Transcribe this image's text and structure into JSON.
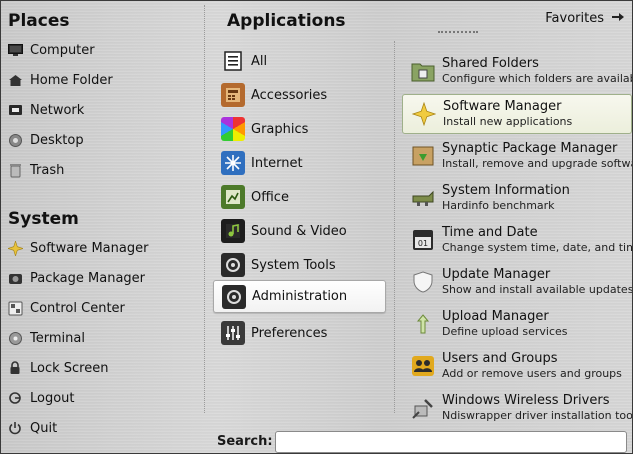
{
  "places": {
    "title": "Places",
    "items": [
      {
        "label": "Computer",
        "icon": "monitor-icon"
      },
      {
        "label": "Home Folder",
        "icon": "home-icon"
      },
      {
        "label": "Network",
        "icon": "network-icon"
      },
      {
        "label": "Desktop",
        "icon": "desktop-icon"
      },
      {
        "label": "Trash",
        "icon": "trash-icon"
      }
    ]
  },
  "system": {
    "title": "System",
    "items": [
      {
        "label": "Software Manager",
        "icon": "software-manager-icon"
      },
      {
        "label": "Package Manager",
        "icon": "package-manager-icon"
      },
      {
        "label": "Control Center",
        "icon": "control-center-icon"
      },
      {
        "label": "Terminal",
        "icon": "terminal-icon"
      },
      {
        "label": "Lock Screen",
        "icon": "lock-icon"
      },
      {
        "label": "Logout",
        "icon": "logout-icon"
      },
      {
        "label": "Quit",
        "icon": "power-icon"
      }
    ]
  },
  "applications": {
    "title": "Applications",
    "favorites_label": "Favorites",
    "categories": [
      {
        "label": "All",
        "icon": "all-apps-icon"
      },
      {
        "label": "Accessories",
        "icon": "accessories-icon"
      },
      {
        "label": "Graphics",
        "icon": "graphics-icon"
      },
      {
        "label": "Internet",
        "icon": "internet-icon"
      },
      {
        "label": "Office",
        "icon": "office-icon"
      },
      {
        "label": "Sound & Video",
        "icon": "sound-video-icon"
      },
      {
        "label": "System Tools",
        "icon": "system-tools-icon"
      },
      {
        "label": "Administration",
        "icon": "administration-icon",
        "active": true
      },
      {
        "label": "Preferences",
        "icon": "preferences-icon"
      }
    ],
    "apps": [
      {
        "name": "Shared Folders",
        "desc": "Configure which folders are available ...",
        "icon": "shared-folders-icon"
      },
      {
        "name": "Software Manager",
        "desc": "Install new applications",
        "icon": "software-manager-icon",
        "active": true
      },
      {
        "name": "Synaptic Package Manager",
        "desc": "Install, remove and upgrade software...",
        "icon": "synaptic-icon"
      },
      {
        "name": "System Information",
        "desc": "Hardinfo benchmark",
        "icon": "system-info-icon"
      },
      {
        "name": "Time and Date",
        "desc": "Change system time, date, and timez...",
        "icon": "calendar-icon"
      },
      {
        "name": "Update Manager",
        "desc": "Show and install available updates",
        "icon": "shield-icon"
      },
      {
        "name": "Upload Manager",
        "desc": "Define upload services",
        "icon": "upload-icon"
      },
      {
        "name": "Users and Groups",
        "desc": "Add or remove users and groups",
        "icon": "users-icon"
      },
      {
        "name": "Windows Wireless Drivers",
        "desc": "Ndiswrapper driver installation tool",
        "icon": "wireless-driver-icon"
      }
    ]
  },
  "search": {
    "label": "Search:",
    "value": ""
  }
}
